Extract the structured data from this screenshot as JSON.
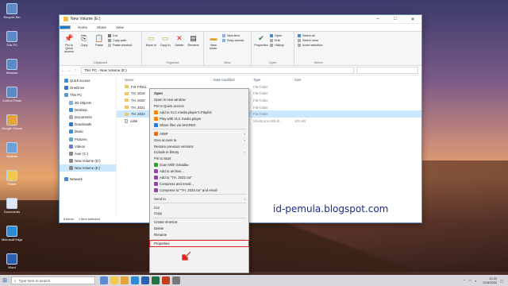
{
  "desktop": {
    "icons": [
      {
        "label": "Recycle Bin"
      },
      {
        "label": "This PC"
      },
      {
        "label": "Network"
      },
      {
        "label": "Control Panel"
      },
      {
        "label": "Google Chrome"
      },
      {
        "label": "Aplikasi"
      },
      {
        "label": "Folder"
      },
      {
        "label": "Documents"
      },
      {
        "label": "Microsoft Edge"
      },
      {
        "label": "Word"
      },
      {
        "label": "Excel"
      },
      {
        "label": "Notepad"
      }
    ]
  },
  "window": {
    "title": "New Volume (E:)",
    "tabs": [
      "File",
      "Home",
      "Share",
      "View"
    ],
    "ribbon": {
      "clipboard": {
        "label": "Clipboard",
        "pin": "Pin to Quick access",
        "copy": "Copy",
        "paste": "Paste",
        "cut": "Cut",
        "copy_path": "Copy path",
        "paste_shortcut": "Paste shortcut"
      },
      "organize": {
        "label": "Organize",
        "move_to": "Move to",
        "copy_to": "Copy to",
        "delete": "Delete",
        "rename": "Rename"
      },
      "new": {
        "label": "New",
        "new_folder": "New folder",
        "new_item": "New item",
        "easy_access": "Easy access"
      },
      "open": {
        "label": "Open",
        "properties": "Properties",
        "open": "Open",
        "edit": "Edit",
        "history": "History"
      },
      "select": {
        "label": "Select",
        "select_all": "Select all",
        "select_none": "Select none",
        "invert_selection": "Invert selection"
      }
    },
    "address": "This PC  ›  New Volume (E:)",
    "nav_pane": [
      {
        "label": "Quick access"
      },
      {
        "label": "OneDrive"
      },
      {
        "label": "This PC"
      },
      {
        "label": "3D Objects"
      },
      {
        "label": "Desktop"
      },
      {
        "label": "Documents"
      },
      {
        "label": "Downloads"
      },
      {
        "label": "Music"
      },
      {
        "label": "Pictures"
      },
      {
        "label": "Videos"
      },
      {
        "label": "Acer (C:)"
      },
      {
        "label": "New Volume (D:)"
      },
      {
        "label": "New Volume (E:)"
      },
      {
        "label": "Network"
      }
    ],
    "columns": {
      "name": "Name",
      "date": "Date modified",
      "type": "Type",
      "size": "Size"
    },
    "files": [
      {
        "name": "FIX FINAL",
        "type": "File folder",
        "size": ""
      },
      {
        "name": "TH. 2019",
        "type": "File folder",
        "size": ""
      },
      {
        "name": "TH. 2020",
        "type": "File folder",
        "size": ""
      },
      {
        "name": "TH. 2021",
        "type": "File folder",
        "size": ""
      },
      {
        "name": "TH. 2022",
        "type": "File folder",
        "size": ""
      },
      {
        "name": "cobk",
        "type": "Shortcut to MS-D...",
        "size": "101 KB"
      }
    ],
    "status": {
      "items": "6 items",
      "selected": "1 item selected"
    }
  },
  "context_menu": {
    "items": [
      {
        "label": "Open"
      },
      {
        "label": "Open in new window"
      },
      {
        "label": "Pin to Quick access"
      },
      {
        "label": "Add to VLC media player's Playlist"
      },
      {
        "label": "Play with VLC media player"
      },
      {
        "label": "Share files via SHAREit"
      },
      {
        "label": "AIMP"
      },
      {
        "label": "Give access to"
      },
      {
        "label": "Restore previous versions"
      },
      {
        "label": "Include in library"
      },
      {
        "label": "Pin to Start"
      },
      {
        "label": "Scan With Smadav"
      },
      {
        "label": "Add to archive..."
      },
      {
        "label": "Add to \"TH. 2022.rar\""
      },
      {
        "label": "Compress and email..."
      },
      {
        "label": "Compress to \"TH. 2022.rar\" and email"
      },
      {
        "label": "Send to"
      },
      {
        "label": "Cut"
      },
      {
        "label": "Copy"
      },
      {
        "label": "Create shortcut"
      },
      {
        "label": "Delete"
      },
      {
        "label": "Rename"
      },
      {
        "label": "Properties"
      }
    ]
  },
  "watermark": "id-pemula.blogspot.com",
  "taskbar": {
    "search_placeholder": "Type here to search",
    "tray_time": "12:20",
    "tray_date": "2/16/2022"
  }
}
